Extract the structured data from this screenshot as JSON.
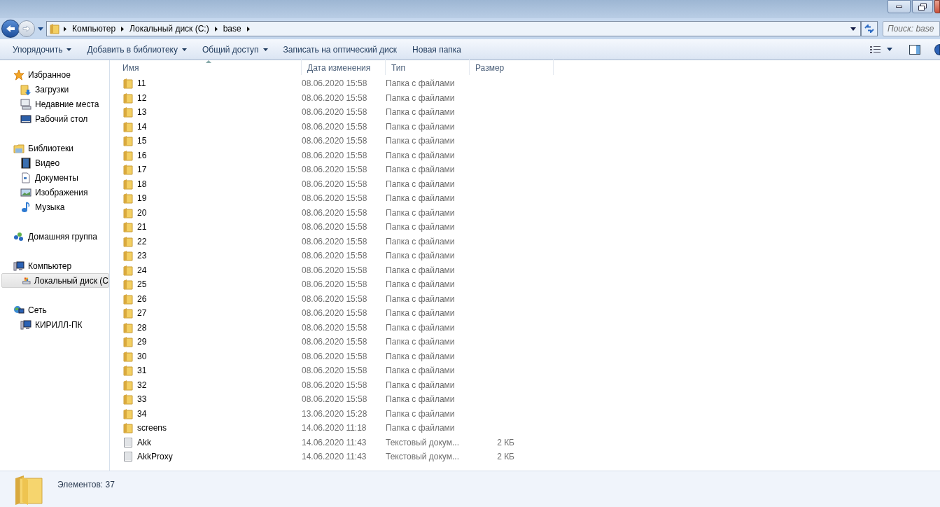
{
  "address": {
    "breadcrumbs": [
      "Компьютер",
      "Локальный диск (C:)",
      "base"
    ]
  },
  "search": {
    "placeholder": "Поиск: base"
  },
  "toolbar": {
    "items": [
      {
        "label": "Упорядочить",
        "dropdown": true
      },
      {
        "label": "Добавить в библиотеку",
        "dropdown": true
      },
      {
        "label": "Общий доступ",
        "dropdown": true
      },
      {
        "label": "Записать на оптический диск",
        "dropdown": false
      },
      {
        "label": "Новая папка",
        "dropdown": false
      }
    ]
  },
  "sidebar": {
    "groups": [
      {
        "label": "Избранное",
        "kind": "star",
        "children": [
          {
            "label": "Загрузки",
            "kind": "downloads",
            "selected": false
          },
          {
            "label": "Недавние места",
            "kind": "recent",
            "selected": false
          },
          {
            "label": "Рабочий стол",
            "kind": "desktop",
            "selected": false
          }
        ]
      },
      {
        "label": "Библиотеки",
        "kind": "library",
        "children": [
          {
            "label": "Видео",
            "kind": "video",
            "selected": false
          },
          {
            "label": "Документы",
            "kind": "document",
            "selected": false
          },
          {
            "label": "Изображения",
            "kind": "picture",
            "selected": false
          },
          {
            "label": "Музыка",
            "kind": "music",
            "selected": false
          }
        ]
      },
      {
        "label": "Домашняя группа",
        "kind": "homegroup"
      },
      {
        "label": "Компьютер",
        "kind": "computer",
        "children": [
          {
            "label": "Локальный диск (С",
            "kind": "drive",
            "selected": true
          }
        ]
      },
      {
        "label": "Сеть",
        "kind": "network",
        "children": [
          {
            "label": "КИРИЛЛ-ПК",
            "kind": "computer",
            "selected": false
          }
        ]
      }
    ]
  },
  "table": {
    "columns": [
      "Имя",
      "Дата изменения",
      "Тип",
      "Размер"
    ],
    "rows": [
      {
        "kind": "folder",
        "name": "11",
        "date": "08.06.2020 15:58",
        "type": "Папка с файлами"
      },
      {
        "kind": "folder",
        "name": "12",
        "date": "08.06.2020 15:58",
        "type": "Папка с файлами"
      },
      {
        "kind": "folder",
        "name": "13",
        "date": "08.06.2020 15:58",
        "type": "Папка с файлами"
      },
      {
        "kind": "folder",
        "name": "14",
        "date": "08.06.2020 15:58",
        "type": "Папка с файлами"
      },
      {
        "kind": "folder",
        "name": "15",
        "date": "08.06.2020 15:58",
        "type": "Папка с файлами"
      },
      {
        "kind": "folder",
        "name": "16",
        "date": "08.06.2020 15:58",
        "type": "Папка с файлами"
      },
      {
        "kind": "folder",
        "name": "17",
        "date": "08.06.2020 15:58",
        "type": "Папка с файлами"
      },
      {
        "kind": "folder",
        "name": "18",
        "date": "08.06.2020 15:58",
        "type": "Папка с файлами"
      },
      {
        "kind": "folder",
        "name": "19",
        "date": "08.06.2020 15:58",
        "type": "Папка с файлами"
      },
      {
        "kind": "folder",
        "name": "20",
        "date": "08.06.2020 15:58",
        "type": "Папка с файлами"
      },
      {
        "kind": "folder",
        "name": "21",
        "date": "08.06.2020 15:58",
        "type": "Папка с файлами"
      },
      {
        "kind": "folder",
        "name": "22",
        "date": "08.06.2020 15:58",
        "type": "Папка с файлами"
      },
      {
        "kind": "folder",
        "name": "23",
        "date": "08.06.2020 15:58",
        "type": "Папка с файлами"
      },
      {
        "kind": "folder",
        "name": "24",
        "date": "08.06.2020 15:58",
        "type": "Папка с файлами"
      },
      {
        "kind": "folder",
        "name": "25",
        "date": "08.06.2020 15:58",
        "type": "Папка с файлами"
      },
      {
        "kind": "folder",
        "name": "26",
        "date": "08.06.2020 15:58",
        "type": "Папка с файлами"
      },
      {
        "kind": "folder",
        "name": "27",
        "date": "08.06.2020 15:58",
        "type": "Папка с файлами"
      },
      {
        "kind": "folder",
        "name": "28",
        "date": "08.06.2020 15:58",
        "type": "Папка с файлами"
      },
      {
        "kind": "folder",
        "name": "29",
        "date": "08.06.2020 15:58",
        "type": "Папка с файлами"
      },
      {
        "kind": "folder",
        "name": "30",
        "date": "08.06.2020 15:58",
        "type": "Папка с файлами"
      },
      {
        "kind": "folder",
        "name": "31",
        "date": "08.06.2020 15:58",
        "type": "Папка с файлами"
      },
      {
        "kind": "folder",
        "name": "32",
        "date": "08.06.2020 15:58",
        "type": "Папка с файлами"
      },
      {
        "kind": "folder",
        "name": "33",
        "date": "08.06.2020 15:58",
        "type": "Папка с файлами"
      },
      {
        "kind": "folder",
        "name": "34",
        "date": "13.06.2020 15:28",
        "type": "Папка с файлами"
      },
      {
        "kind": "folder",
        "name": "screens",
        "date": "14.06.2020 11:18",
        "type": "Папка с файлами"
      },
      {
        "kind": "file",
        "name": "Akk",
        "date": "14.06.2020 11:43",
        "type": "Текстовый докум...",
        "size": "2 КБ"
      },
      {
        "kind": "file",
        "name": "AkkProxy",
        "date": "14.06.2020 11:43",
        "type": "Текстовый докум...",
        "size": "2 КБ"
      }
    ]
  },
  "status_bar": {
    "text": "Элементов: 37"
  }
}
